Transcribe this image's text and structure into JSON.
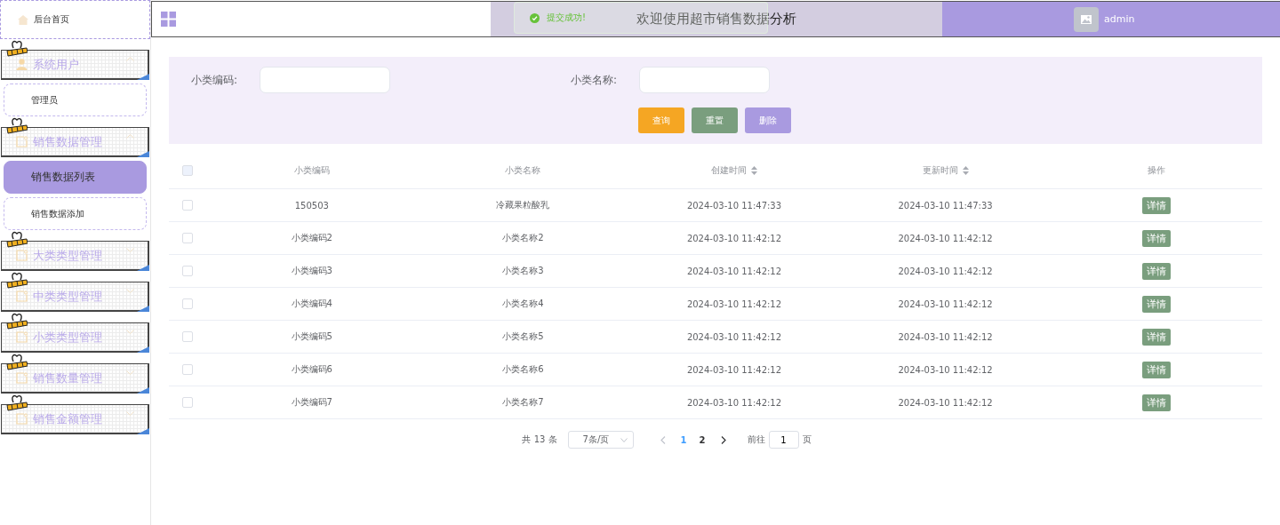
{
  "menu": [
    {
      "kind": "home",
      "label": "后台首页"
    },
    {
      "kind": "group",
      "label": "系统用户",
      "expanded": true,
      "children": [
        {
          "label": "管理员",
          "selected": false
        }
      ]
    },
    {
      "kind": "group",
      "label": "销售数据管理",
      "expanded": true,
      "children": [
        {
          "label": "销售数据列表",
          "selected": true
        },
        {
          "label": "销售数据添加",
          "selected": false
        }
      ]
    },
    {
      "kind": "group",
      "label": "大类类型管理",
      "expanded": false
    },
    {
      "kind": "group",
      "label": "中类类型管理",
      "expanded": false
    },
    {
      "kind": "group",
      "label": "小类类型管理",
      "expanded": false
    },
    {
      "kind": "group",
      "label": "销售数量管理",
      "expanded": false
    },
    {
      "kind": "group",
      "label": "销售金额管理",
      "expanded": false
    }
  ],
  "header": {
    "title": "欢迎使用超市销售数据分析",
    "user": "admin"
  },
  "toast": {
    "message": "提交成功!"
  },
  "search": {
    "fields": [
      {
        "label": "小类编码:"
      },
      {
        "label": "小类名称:"
      }
    ],
    "buttons": [
      {
        "label": "查询",
        "kind": "query"
      },
      {
        "label": "重置",
        "kind": "reset"
      },
      {
        "label": "删除",
        "kind": "delete"
      }
    ]
  },
  "table": {
    "select_all_checked": false,
    "columns": [
      {
        "label": "小类编码",
        "sortable": false
      },
      {
        "label": "小类名称",
        "sortable": false
      },
      {
        "label": "创建时间",
        "sortable": true
      },
      {
        "label": "更新时间",
        "sortable": true
      },
      {
        "label": "操作",
        "sortable": false
      }
    ],
    "rows": [
      {
        "checked": false,
        "cells": [
          "150503",
          "冷藏果粒酸乳",
          "2024-03-10 11:47:33",
          "2024-03-10 11:47:33"
        ],
        "action": "详情"
      },
      {
        "checked": false,
        "cells": [
          "小类编码2",
          "小类名称2",
          "2024-03-10 11:42:12",
          "2024-03-10 11:42:12"
        ],
        "action": "详情"
      },
      {
        "checked": false,
        "cells": [
          "小类编码3",
          "小类名称3",
          "2024-03-10 11:42:12",
          "2024-03-10 11:42:12"
        ],
        "action": "详情"
      },
      {
        "checked": false,
        "cells": [
          "小类编码4",
          "小类名称4",
          "2024-03-10 11:42:12",
          "2024-03-10 11:42:12"
        ],
        "action": "详情"
      },
      {
        "checked": false,
        "cells": [
          "小类编码5",
          "小类名称5",
          "2024-03-10 11:42:12",
          "2024-03-10 11:42:12"
        ],
        "action": "详情"
      },
      {
        "checked": false,
        "cells": [
          "小类编码6",
          "小类名称6",
          "2024-03-10 11:42:12",
          "2024-03-10 11:42:12"
        ],
        "action": "详情"
      },
      {
        "checked": false,
        "cells": [
          "小类编码7",
          "小类名称7",
          "2024-03-10 11:42:12",
          "2024-03-10 11:42:12"
        ],
        "action": "详情"
      }
    ]
  },
  "pagination": {
    "total": "共 13 条",
    "page_size": "7条/页",
    "pages": [
      {
        "label": "1",
        "selected": true
      },
      {
        "label": "2",
        "selected": false
      }
    ],
    "goto_label": "前往",
    "goto_value": "1",
    "goto_suffix": "页"
  }
}
